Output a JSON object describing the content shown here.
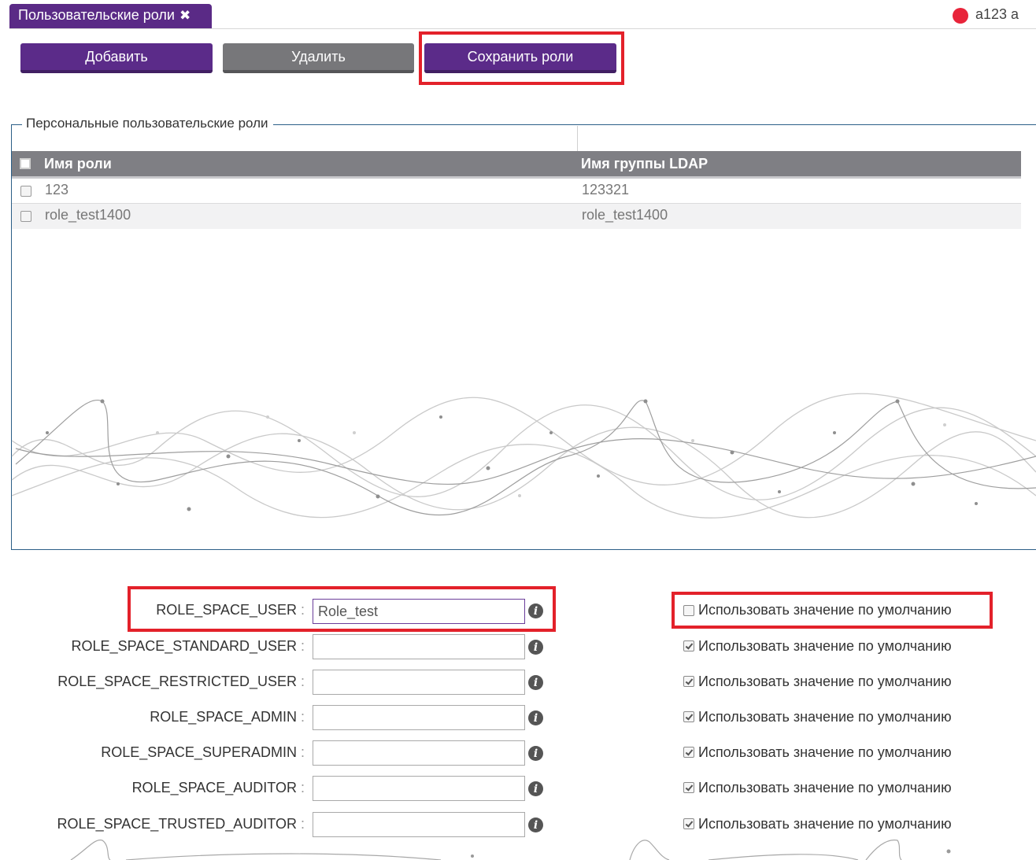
{
  "tab": {
    "label": "Пользовательские роли",
    "close_icon": "close-icon"
  },
  "user": {
    "name": "a123 a",
    "status_color": "#e8243a"
  },
  "toolbar": {
    "add_label": "Добавить",
    "delete_label": "Удалить",
    "save_label": "Сохранить роли"
  },
  "roles_panel": {
    "legend": "Персональные пользовательские роли",
    "columns": [
      "Имя роли",
      "Имя группы LDAP"
    ],
    "rows": [
      {
        "role": "123",
        "ldap": "123321"
      },
      {
        "role": "role_test1400",
        "ldap": "role_test1400"
      }
    ]
  },
  "mapping": {
    "default_label": "Использовать значение по умолчанию",
    "fields": [
      {
        "name": "ROLE_SPACE_USER",
        "sep": ":",
        "value": "Role_test",
        "use_default": false
      },
      {
        "name": "ROLE_SPACE_STANDARD_USER",
        "sep": ":",
        "value": "",
        "use_default": true
      },
      {
        "name": "ROLE_SPACE_RESTRICTED_USER",
        "sep": ":",
        "value": "",
        "use_default": true
      },
      {
        "name": "ROLE_SPACE_ADMIN",
        "sep": ":",
        "value": "",
        "use_default": true
      },
      {
        "name": "ROLE_SPACE_SUPERADMIN",
        "sep": ":",
        "value": "",
        "use_default": true
      },
      {
        "name": "ROLE_SPACE_AUDITOR",
        "sep": ":",
        "value": "",
        "use_default": true
      },
      {
        "name": "ROLE_SPACE_TRUSTED_AUDITOR",
        "sep": ":",
        "value": "",
        "use_default": true
      }
    ]
  },
  "colors": {
    "accent": "#5b2b89",
    "button_gray": "#77777a",
    "highlight": "#e3212a",
    "header": "#7f7f84"
  }
}
